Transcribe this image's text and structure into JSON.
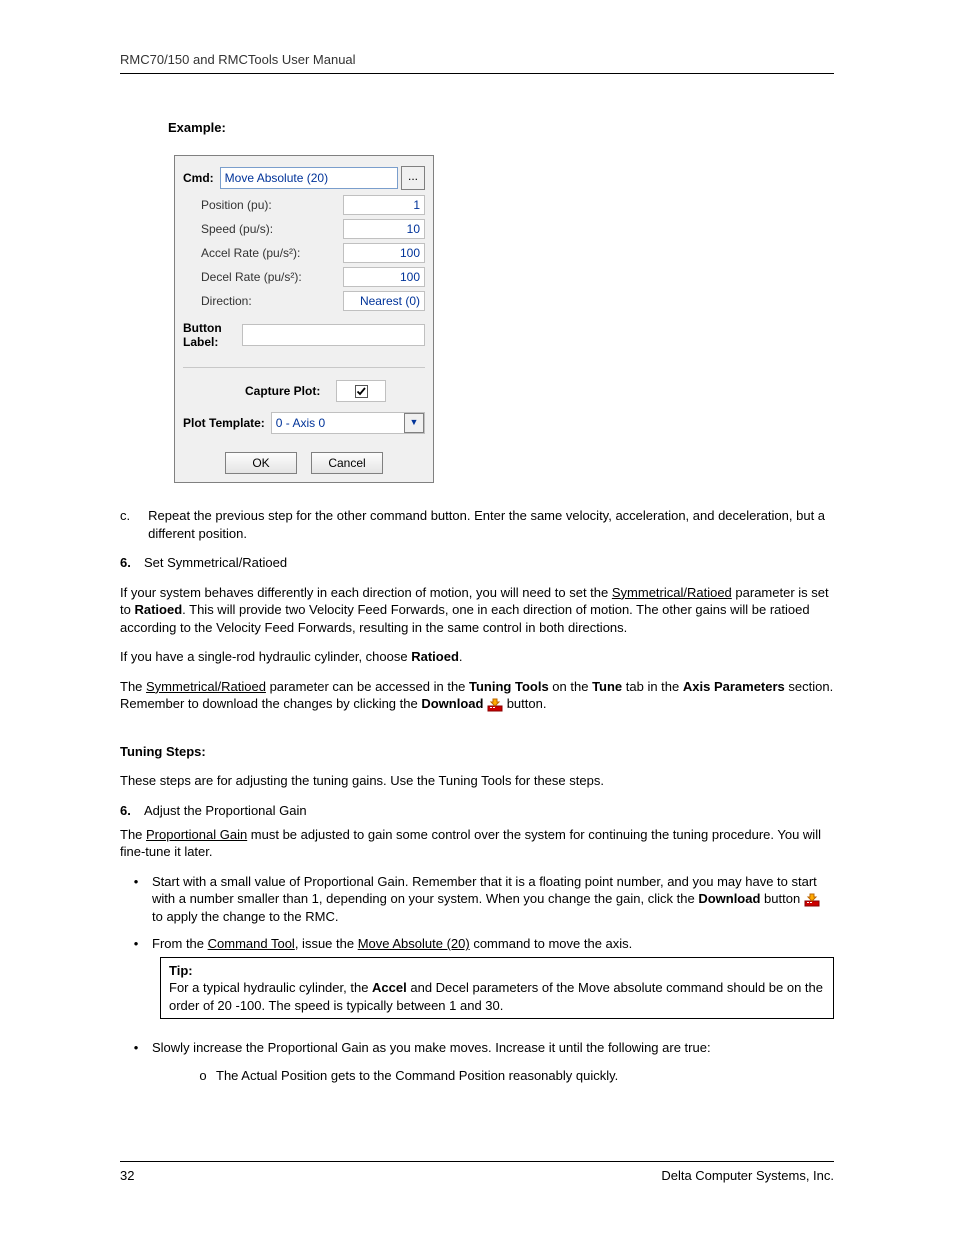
{
  "header": {
    "title": "RMC70/150 and RMCTools User Manual"
  },
  "example": {
    "label": "Example:"
  },
  "dialog": {
    "cmd_label": "Cmd:",
    "cmd_value": "Move Absolute (20)",
    "ellipsis": "...",
    "params": [
      {
        "label": "Position (pu):",
        "value": "1"
      },
      {
        "label": "Speed (pu/s):",
        "value": "10"
      },
      {
        "label": "Accel Rate (pu/s²):",
        "value": "100"
      },
      {
        "label": "Decel Rate (pu/s²):",
        "value": "100"
      },
      {
        "label": "Direction:",
        "value": "Nearest (0)"
      }
    ],
    "button_label_label": "Button Label:",
    "capture_plot_label": "Capture Plot:",
    "plot_template_label": "Plot Template:",
    "plot_template_value": "0 - Axis 0",
    "ok": "OK",
    "cancel": "Cancel"
  },
  "step_c": {
    "marker": "c.",
    "text": "Repeat the previous step for the other command button. Enter the same velocity, acceleration, and deceleration, but a different position."
  },
  "step6a": {
    "marker": "6.",
    "text": "Set Symmetrical/Ratioed"
  },
  "para1": {
    "pre": "If your system behaves differently in each direction of motion, you will need to set the ",
    "link": "Symmetrical/Ratioed",
    "mid": " parameter is set to ",
    "bold": "Ratioed",
    "post": ". This will provide two Velocity Feed Forwards, one in each direction of motion. The other gains will be ratioed according to the Velocity Feed Forwards, resulting in the same control in both directions."
  },
  "para2": {
    "pre": "If you have a single-rod hydraulic cylinder, choose ",
    "bold": "Ratioed",
    "post": "."
  },
  "para3": {
    "pre": "The ",
    "link": "Symmetrical/Ratioed",
    "mid1": " parameter can be accessed in the ",
    "b1": "Tuning Tools",
    "mid2": " on the ",
    "b2": "Tune",
    "mid3": " tab in the ",
    "b3": "Axis Parameters",
    "mid4": " section. Remember to download the changes by clicking the ",
    "b4": "Download",
    "post": " button."
  },
  "tuning_heading": "Tuning Steps:",
  "tuning_intro": "These steps are for adjusting the tuning gains. Use the Tuning Tools for these steps.",
  "step6b": {
    "marker": "6.",
    "text": "Adjust the Proportional Gain"
  },
  "para4": {
    "pre": "The ",
    "link": "Proportional Gain",
    "post": " must be adjusted to gain some control over the system for continuing the tuning procedure. You will fine-tune it later."
  },
  "bullets": {
    "b1": {
      "pre": "Start with a small value of Proportional Gain. Remember that it is a floating point number, and you may have to start with a number smaller than 1, depending on your system. When you change the gain, click the ",
      "bold": "Download",
      "mid": " button ",
      "post": " to apply the change to the RMC."
    },
    "b2": {
      "pre": "From the ",
      "link1": "Command Tool",
      "mid": ", issue the ",
      "link2": "Move Absolute (20)",
      "post": " command to move the axis."
    },
    "b3": "Slowly increase the Proportional Gain as you make moves. Increase it until the following are true:"
  },
  "tip": {
    "label": "Tip:",
    "pre": "For a typical hydraulic cylinder, the ",
    "bold": "Accel",
    "post": " and Decel parameters of the Move absolute command should be on the order of 20 -100. The speed is typically between 1 and 30."
  },
  "sub": {
    "marker": "o",
    "text": "The Actual Position gets to the Command Position reasonably quickly."
  },
  "footer": {
    "page": "32",
    "company": "Delta Computer Systems, Inc."
  }
}
